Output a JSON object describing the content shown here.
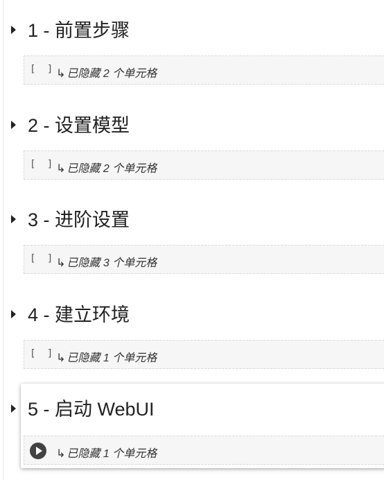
{
  "sections": [
    {
      "title": "1 - 前置步骤",
      "hidden_text": "已隐藏 2 个单元格"
    },
    {
      "title": "2 - 设置模型",
      "hidden_text": "已隐藏 2 个单元格"
    },
    {
      "title": "3 - 进阶设置",
      "hidden_text": "已隐藏 3 个单元格"
    },
    {
      "title": "4 - 建立环境",
      "hidden_text": "已隐藏 1 个单元格"
    },
    {
      "title": "5 - 启动 WebUI",
      "hidden_text": "已隐藏 1 个单元格"
    }
  ],
  "cell_brackets": "[ ]",
  "hidden_arrow": "↳",
  "icons": {
    "collapse": "caret-right-icon",
    "run": "play-circle-icon"
  },
  "colors": {
    "hidden_cell_bg": "#f6f6f6",
    "run_button": "#424242",
    "text": "#212121"
  }
}
